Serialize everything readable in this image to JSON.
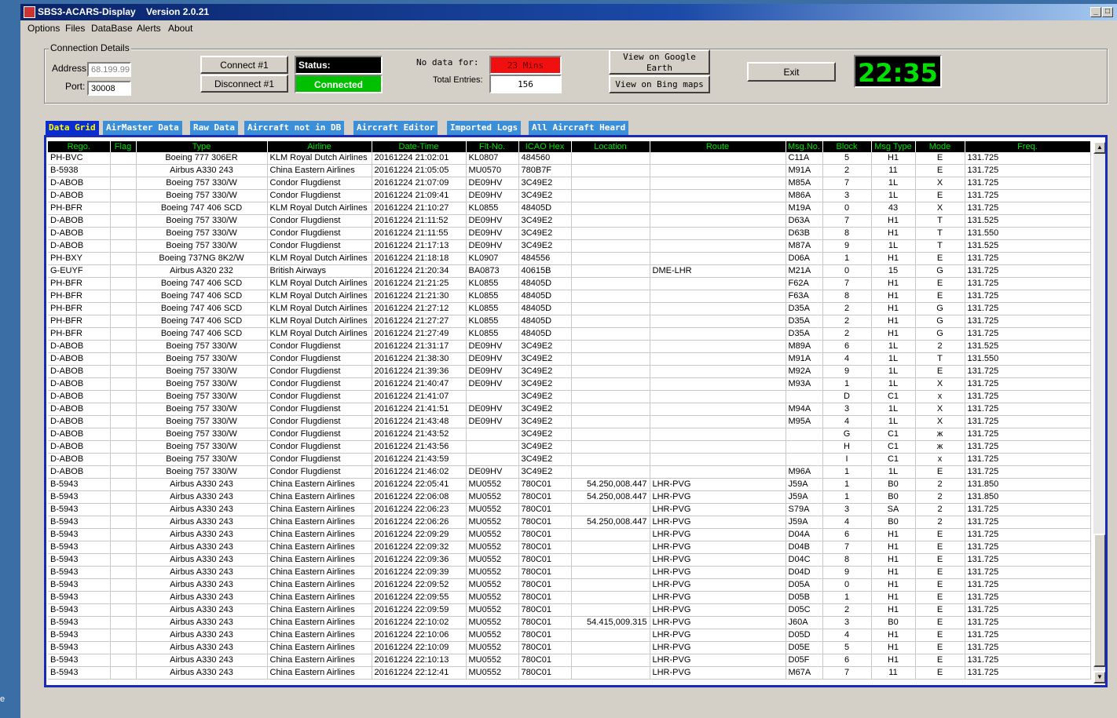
{
  "window": {
    "title": "SBS3-ACARS-Display    Version 2.0.21"
  },
  "menu": [
    "Options",
    "Files",
    "DataBase",
    "Alerts",
    "About"
  ],
  "connection": {
    "legend": "Connection Details",
    "address_label": "Address",
    "address_value": "68.199.99",
    "port_label": "Port:",
    "port_value": "30008",
    "connect_label": "Connect #1",
    "disconnect_label": "Disconnect #1",
    "status_label": "Status:",
    "status_value": "Connected",
    "nodata_label": "No data for:",
    "nodata_value": "23 Mins",
    "total_label": "Total Entries:",
    "total_value": "156",
    "google_label": "View on Google Earth",
    "bing_label": "View on Bing maps",
    "exit_label": "Exit",
    "clock": "22:35"
  },
  "tabs": [
    "Data Grid",
    "AirMaster Data",
    "Raw Data",
    "Aircraft not in DB",
    "Aircraft Editor",
    "Imported Logs",
    "All Aircraft Heard"
  ],
  "desktop_glyph": "e",
  "grid": {
    "columns": [
      "Rego.",
      "Flag",
      "Type",
      "Airline",
      "Date-Time",
      "Flt-No.",
      "ICAO Hex",
      "Location",
      "Route",
      "Msg.No.",
      "Block",
      "Msg Type",
      "Mode",
      "Freq."
    ],
    "rows": [
      [
        "PH-BVC",
        "",
        "Boeing 777 306ER",
        "KLM Royal Dutch Airlines",
        "20161224 21:02:01",
        "KL0807",
        "484560",
        "",
        "",
        "C11A",
        "5",
        "H1",
        "E",
        "131.725"
      ],
      [
        "B-5938",
        "",
        "Airbus A330 243",
        "China Eastern Airlines",
        "20161224 21:05:05",
        "MU0570",
        "780B7F",
        "",
        "",
        "M91A",
        "2",
        "11",
        "E",
        "131.725"
      ],
      [
        "D-ABOB",
        "",
        "Boeing 757 330/W",
        "Condor Flugdienst",
        "20161224 21:07:09",
        "DE09HV",
        "3C49E2",
        "",
        "",
        "M85A",
        "7",
        "1L",
        "X",
        "131.725"
      ],
      [
        "D-ABOB",
        "",
        "Boeing 757 330/W",
        "Condor Flugdienst",
        "20161224 21:09:41",
        "DE09HV",
        "3C49E2",
        "",
        "",
        "M86A",
        "3",
        "1L",
        "E",
        "131.725"
      ],
      [
        "PH-BFR",
        "",
        "Boeing 747 406 SCD",
        "KLM Royal Dutch Airlines",
        "20161224 21:10:27",
        "KL0855",
        "48405D",
        "",
        "",
        "M19A",
        "0",
        "43",
        "X",
        "131.725"
      ],
      [
        "D-ABOB",
        "",
        "Boeing 757 330/W",
        "Condor Flugdienst",
        "20161224 21:11:52",
        "DE09HV",
        "3C49E2",
        "",
        "",
        "D63A",
        "7",
        "H1",
        "T",
        "131.525"
      ],
      [
        "D-ABOB",
        "",
        "Boeing 757 330/W",
        "Condor Flugdienst",
        "20161224 21:11:55",
        "DE09HV",
        "3C49E2",
        "",
        "",
        "D63B",
        "8",
        "H1",
        "T",
        "131.550"
      ],
      [
        "D-ABOB",
        "",
        "Boeing 757 330/W",
        "Condor Flugdienst",
        "20161224 21:17:13",
        "DE09HV",
        "3C49E2",
        "",
        "",
        "M87A",
        "9",
        "1L",
        "T",
        "131.525"
      ],
      [
        "PH-BXY",
        "",
        "Boeing 737NG 8K2/W",
        "KLM Royal Dutch Airlines",
        "20161224 21:18:18",
        "KL0907",
        "484556",
        "",
        "",
        "D06A",
        "1",
        "H1",
        "E",
        "131.725"
      ],
      [
        "G-EUYF",
        "",
        "Airbus A320 232",
        "British Airways",
        "20161224 21:20:34",
        "BA0873",
        "40615B",
        "",
        "DME-LHR",
        "M21A",
        "0",
        "15",
        "G",
        "131.725"
      ],
      [
        "PH-BFR",
        "",
        "Boeing 747 406 SCD",
        "KLM Royal Dutch Airlines",
        "20161224 21:21:25",
        "KL0855",
        "48405D",
        "",
        "",
        "F62A",
        "7",
        "H1",
        "E",
        "131.725"
      ],
      [
        "PH-BFR",
        "",
        "Boeing 747 406 SCD",
        "KLM Royal Dutch Airlines",
        "20161224 21:21:30",
        "KL0855",
        "48405D",
        "",
        "",
        "F63A",
        "8",
        "H1",
        "E",
        "131.725"
      ],
      [
        "PH-BFR",
        "",
        "Boeing 747 406 SCD",
        "KLM Royal Dutch Airlines",
        "20161224 21:27:12",
        "KL0855",
        "48405D",
        "",
        "",
        "D35A",
        "2",
        "H1",
        "G",
        "131.725"
      ],
      [
        "PH-BFR",
        "",
        "Boeing 747 406 SCD",
        "KLM Royal Dutch Airlines",
        "20161224 21:27:27",
        "KL0855",
        "48405D",
        "",
        "",
        "D35A",
        "2",
        "H1",
        "G",
        "131.725"
      ],
      [
        "PH-BFR",
        "",
        "Boeing 747 406 SCD",
        "KLM Royal Dutch Airlines",
        "20161224 21:27:49",
        "KL0855",
        "48405D",
        "",
        "",
        "D35A",
        "2",
        "H1",
        "G",
        "131.725"
      ],
      [
        "D-ABOB",
        "",
        "Boeing 757 330/W",
        "Condor Flugdienst",
        "20161224 21:31:17",
        "DE09HV",
        "3C49E2",
        "",
        "",
        "M89A",
        "6",
        "1L",
        "2",
        "131.525"
      ],
      [
        "D-ABOB",
        "",
        "Boeing 757 330/W",
        "Condor Flugdienst",
        "20161224 21:38:30",
        "DE09HV",
        "3C49E2",
        "",
        "",
        "M91A",
        "4",
        "1L",
        "T",
        "131.550"
      ],
      [
        "D-ABOB",
        "",
        "Boeing 757 330/W",
        "Condor Flugdienst",
        "20161224 21:39:36",
        "DE09HV",
        "3C49E2",
        "",
        "",
        "M92A",
        "9",
        "1L",
        "E",
        "131.725"
      ],
      [
        "D-ABOB",
        "",
        "Boeing 757 330/W",
        "Condor Flugdienst",
        "20161224 21:40:47",
        "DE09HV",
        "3C49E2",
        "",
        "",
        "M93A",
        "1",
        "1L",
        "X",
        "131.725"
      ],
      [
        "D-ABOB",
        "",
        "Boeing 757 330/W",
        "Condor Flugdienst",
        "20161224 21:41:07",
        "",
        "3C49E2",
        "",
        "",
        "",
        "D",
        "C1",
        "x",
        "131.725"
      ],
      [
        "D-ABOB",
        "",
        "Boeing 757 330/W",
        "Condor Flugdienst",
        "20161224 21:41:51",
        "DE09HV",
        "3C49E2",
        "",
        "",
        "M94A",
        "3",
        "1L",
        "X",
        "131.725"
      ],
      [
        "D-ABOB",
        "",
        "Boeing 757 330/W",
        "Condor Flugdienst",
        "20161224 21:43:48",
        "DE09HV",
        "3C49E2",
        "",
        "",
        "M95A",
        "4",
        "1L",
        "X",
        "131.725"
      ],
      [
        "D-ABOB",
        "",
        "Boeing 757 330/W",
        "Condor Flugdienst",
        "20161224 21:43:52",
        "",
        "3C49E2",
        "",
        "",
        "",
        "G",
        "C1",
        "ж",
        "131.725"
      ],
      [
        "D-ABOB",
        "",
        "Boeing 757 330/W",
        "Condor Flugdienst",
        "20161224 21:43:56",
        "",
        "3C49E2",
        "",
        "",
        "",
        "H",
        "C1",
        "ж",
        "131.725"
      ],
      [
        "D-ABOB",
        "",
        "Boeing 757 330/W",
        "Condor Flugdienst",
        "20161224 21:43:59",
        "",
        "3C49E2",
        "",
        "",
        "",
        "I",
        "C1",
        "x",
        "131.725"
      ],
      [
        "D-ABOB",
        "",
        "Boeing 757 330/W",
        "Condor Flugdienst",
        "20161224 21:46:02",
        "DE09HV",
        "3C49E2",
        "",
        "",
        "M96A",
        "1",
        "1L",
        "E",
        "131.725"
      ],
      [
        "B-5943",
        "",
        "Airbus A330 243",
        "China Eastern Airlines",
        "20161224 22:05:41",
        "MU0552",
        "780C01",
        "54.250,008.447",
        "LHR-PVG",
        "J59A",
        "1",
        "B0",
        "2",
        "131.850"
      ],
      [
        "B-5943",
        "",
        "Airbus A330 243",
        "China Eastern Airlines",
        "20161224 22:06:08",
        "MU0552",
        "780C01",
        "54.250,008.447",
        "LHR-PVG",
        "J59A",
        "1",
        "B0",
        "2",
        "131.850"
      ],
      [
        "B-5943",
        "",
        "Airbus A330 243",
        "China Eastern Airlines",
        "20161224 22:06:23",
        "MU0552",
        "780C01",
        "",
        "LHR-PVG",
        "S79A",
        "3",
        "SA",
        "2",
        "131.725"
      ],
      [
        "B-5943",
        "",
        "Airbus A330 243",
        "China Eastern Airlines",
        "20161224 22:06:26",
        "MU0552",
        "780C01",
        "54.250,008.447",
        "LHR-PVG",
        "J59A",
        "4",
        "B0",
        "2",
        "131.725"
      ],
      [
        "B-5943",
        "",
        "Airbus A330 243",
        "China Eastern Airlines",
        "20161224 22:09:29",
        "MU0552",
        "780C01",
        "",
        "LHR-PVG",
        "D04A",
        "6",
        "H1",
        "E",
        "131.725"
      ],
      [
        "B-5943",
        "",
        "Airbus A330 243",
        "China Eastern Airlines",
        "20161224 22:09:32",
        "MU0552",
        "780C01",
        "",
        "LHR-PVG",
        "D04B",
        "7",
        "H1",
        "E",
        "131.725"
      ],
      [
        "B-5943",
        "",
        "Airbus A330 243",
        "China Eastern Airlines",
        "20161224 22:09:36",
        "MU0552",
        "780C01",
        "",
        "LHR-PVG",
        "D04C",
        "8",
        "H1",
        "E",
        "131.725"
      ],
      [
        "B-5943",
        "",
        "Airbus A330 243",
        "China Eastern Airlines",
        "20161224 22:09:39",
        "MU0552",
        "780C01",
        "",
        "LHR-PVG",
        "D04D",
        "9",
        "H1",
        "E",
        "131.725"
      ],
      [
        "B-5943",
        "",
        "Airbus A330 243",
        "China Eastern Airlines",
        "20161224 22:09:52",
        "MU0552",
        "780C01",
        "",
        "LHR-PVG",
        "D05A",
        "0",
        "H1",
        "E",
        "131.725"
      ],
      [
        "B-5943",
        "",
        "Airbus A330 243",
        "China Eastern Airlines",
        "20161224 22:09:55",
        "MU0552",
        "780C01",
        "",
        "LHR-PVG",
        "D05B",
        "1",
        "H1",
        "E",
        "131.725"
      ],
      [
        "B-5943",
        "",
        "Airbus A330 243",
        "China Eastern Airlines",
        "20161224 22:09:59",
        "MU0552",
        "780C01",
        "",
        "LHR-PVG",
        "D05C",
        "2",
        "H1",
        "E",
        "131.725"
      ],
      [
        "B-5943",
        "",
        "Airbus A330 243",
        "China Eastern Airlines",
        "20161224 22:10:02",
        "MU0552",
        "780C01",
        "54.415,009.315",
        "LHR-PVG",
        "J60A",
        "3",
        "B0",
        "E",
        "131.725"
      ],
      [
        "B-5943",
        "",
        "Airbus A330 243",
        "China Eastern Airlines",
        "20161224 22:10:06",
        "MU0552",
        "780C01",
        "",
        "LHR-PVG",
        "D05D",
        "4",
        "H1",
        "E",
        "131.725"
      ],
      [
        "B-5943",
        "",
        "Airbus A330 243",
        "China Eastern Airlines",
        "20161224 22:10:09",
        "MU0552",
        "780C01",
        "",
        "LHR-PVG",
        "D05E",
        "5",
        "H1",
        "E",
        "131.725"
      ],
      [
        "B-5943",
        "",
        "Airbus A330 243",
        "China Eastern Airlines",
        "20161224 22:10:13",
        "MU0552",
        "780C01",
        "",
        "LHR-PVG",
        "D05F",
        "6",
        "H1",
        "E",
        "131.725"
      ],
      [
        "B-5943",
        "",
        "Airbus A330 243",
        "China Eastern Airlines",
        "20161224 22:12:41",
        "MU0552",
        "780C01",
        "",
        "LHR-PVG",
        "M67A",
        "7",
        "11",
        "E",
        "131.725"
      ]
    ]
  }
}
